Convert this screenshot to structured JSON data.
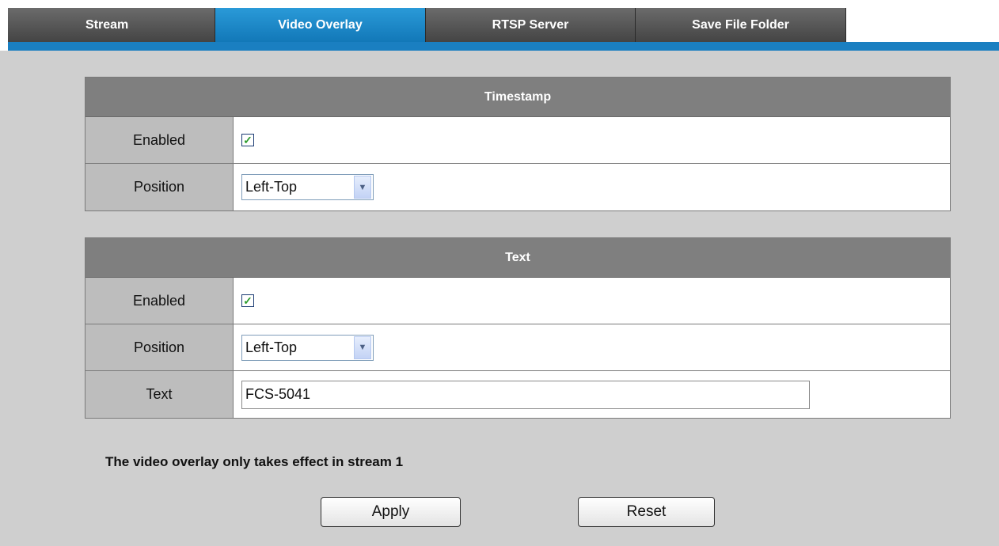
{
  "tabs": [
    {
      "label": "Stream",
      "active": false
    },
    {
      "label": "Video Overlay",
      "active": true
    },
    {
      "label": "RTSP Server",
      "active": false
    },
    {
      "label": "Save File Folder",
      "active": false
    }
  ],
  "timestamp": {
    "title": "Timestamp",
    "enabled_label": "Enabled",
    "enabled": true,
    "position_label": "Position",
    "position_value": "Left-Top"
  },
  "text_panel": {
    "title": "Text",
    "enabled_label": "Enabled",
    "enabled": true,
    "position_label": "Position",
    "position_value": "Left-Top",
    "text_label": "Text",
    "text_value": "FCS-5041"
  },
  "note": "The video overlay only takes effect in stream 1",
  "buttons": {
    "apply": "Apply",
    "reset": "Reset"
  },
  "colors": {
    "accent": "#1a7fc1",
    "tab_inactive": "#555555",
    "header": "#7f7f7f"
  },
  "icons": {
    "check": "checkmark-icon",
    "dropdown": "chevron-down-icon"
  }
}
